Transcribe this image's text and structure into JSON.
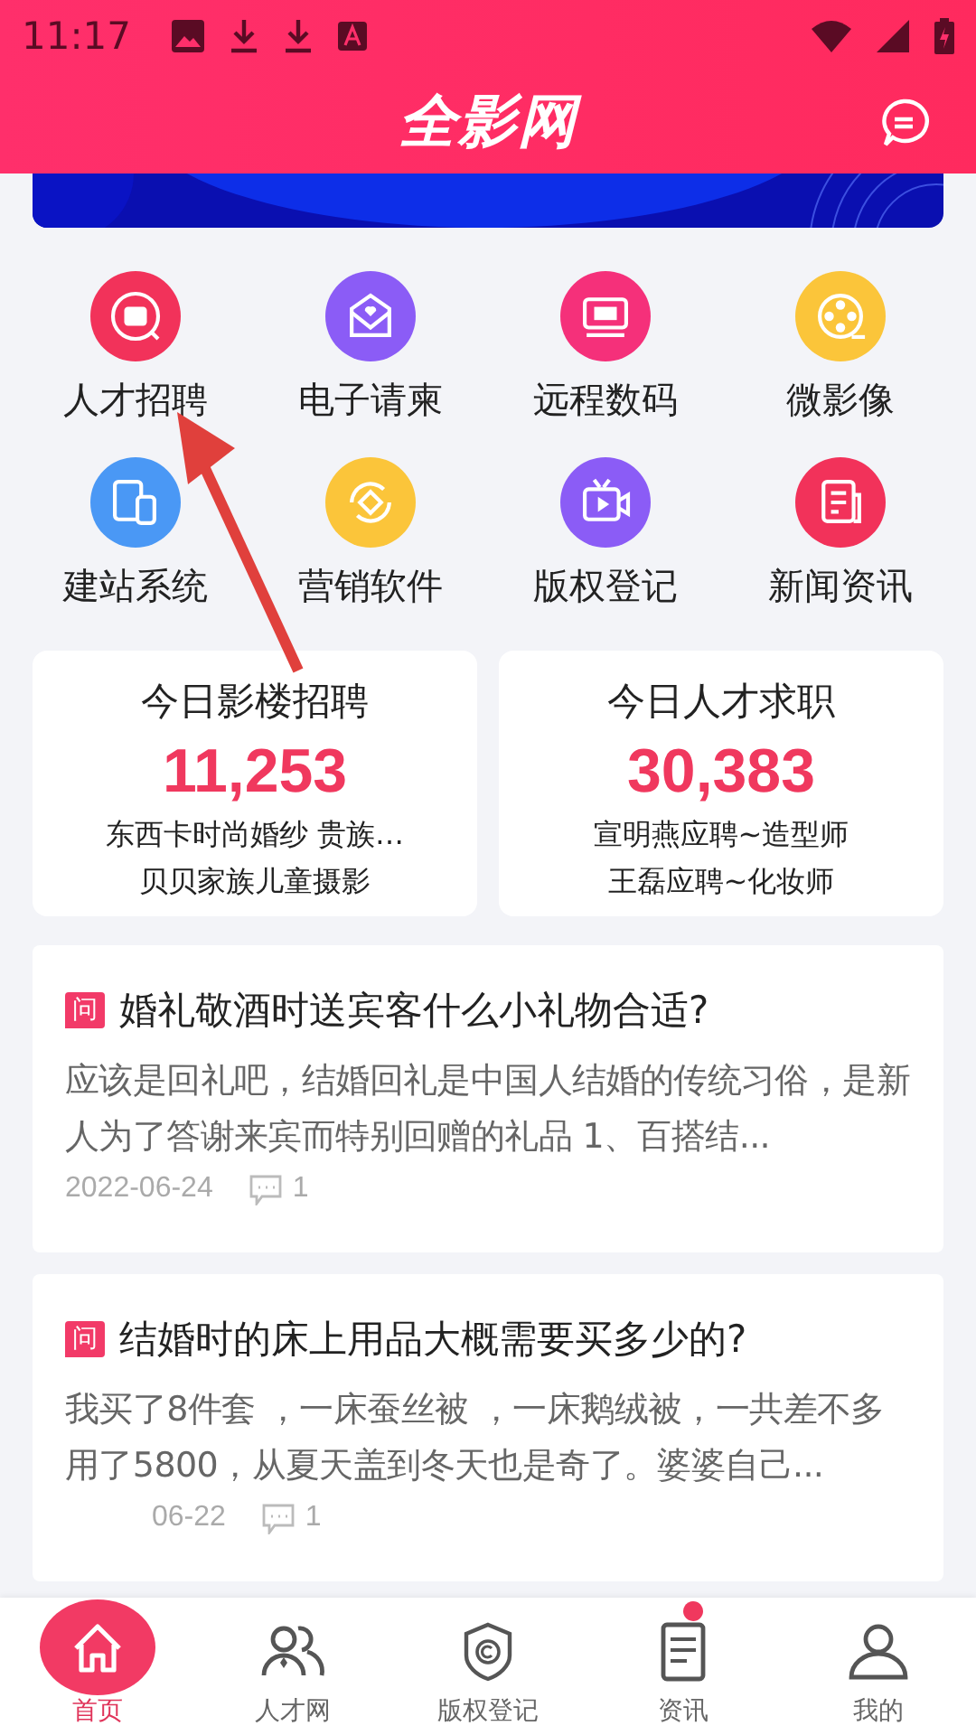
{
  "status_bar": {
    "time": "11:17"
  },
  "header": {
    "logo": "全影网"
  },
  "shortcuts": [
    {
      "label": "人才招聘",
      "kind": "hire",
      "color": "#f2325a"
    },
    {
      "label": "电子请柬",
      "kind": "invite",
      "color": "#8b5cf6"
    },
    {
      "label": "远程数码",
      "kind": "ps",
      "color": "#f5307a"
    },
    {
      "label": "微影像",
      "kind": "film",
      "color": "#fbc53a"
    },
    {
      "label": "建站系统",
      "kind": "devices",
      "color": "#4a98f5"
    },
    {
      "label": "营销软件",
      "kind": "cycle",
      "color": "#fbc53a"
    },
    {
      "label": "版权登记",
      "kind": "tv",
      "color": "#8b5cf6"
    },
    {
      "label": "新闻资讯",
      "kind": "news",
      "color": "#f2325a"
    }
  ],
  "stats": [
    {
      "title": "今日影楼招聘",
      "count": "11,253",
      "ticker": [
        "东西卡时尚婚纱 贵族…",
        "贝贝家族儿童摄影"
      ]
    },
    {
      "title": "今日人才求职",
      "count": "30,383",
      "ticker": [
        "宣明燕应聘~造型师",
        "王磊应聘~化妆师"
      ]
    }
  ],
  "articles": [
    {
      "tag": "问",
      "title": "婚礼敬酒时送宾客什么小礼物合适?",
      "excerpt": "应该是回礼吧，结婚回礼是中国人结婚的传统习俗，是新人为了答谢来宾而特别回赠的礼品 1、百搭结...",
      "date": "2022-06-24",
      "comments": "1"
    },
    {
      "tag": "问",
      "title": "结婚时的床上用品大概需要买多少的?",
      "excerpt": "我买了8件套 ，一床蚕丝被 ，一床鹅绒被，一共差不多用了5800，从夏天盖到冬天也是奇了。婆婆自己...",
      "date": "06-22",
      "comments": "1"
    }
  ],
  "tab_bar": [
    {
      "label": "首页",
      "kind": "home",
      "selected": true,
      "unread": false
    },
    {
      "label": "人才网",
      "kind": "people",
      "selected": false,
      "unread": false
    },
    {
      "label": "版权登记",
      "kind": "shield",
      "selected": false,
      "unread": false
    },
    {
      "label": "资讯",
      "kind": "doc",
      "selected": false,
      "unread": true
    },
    {
      "label": "我的",
      "kind": "user",
      "selected": false,
      "unread": false
    }
  ]
}
